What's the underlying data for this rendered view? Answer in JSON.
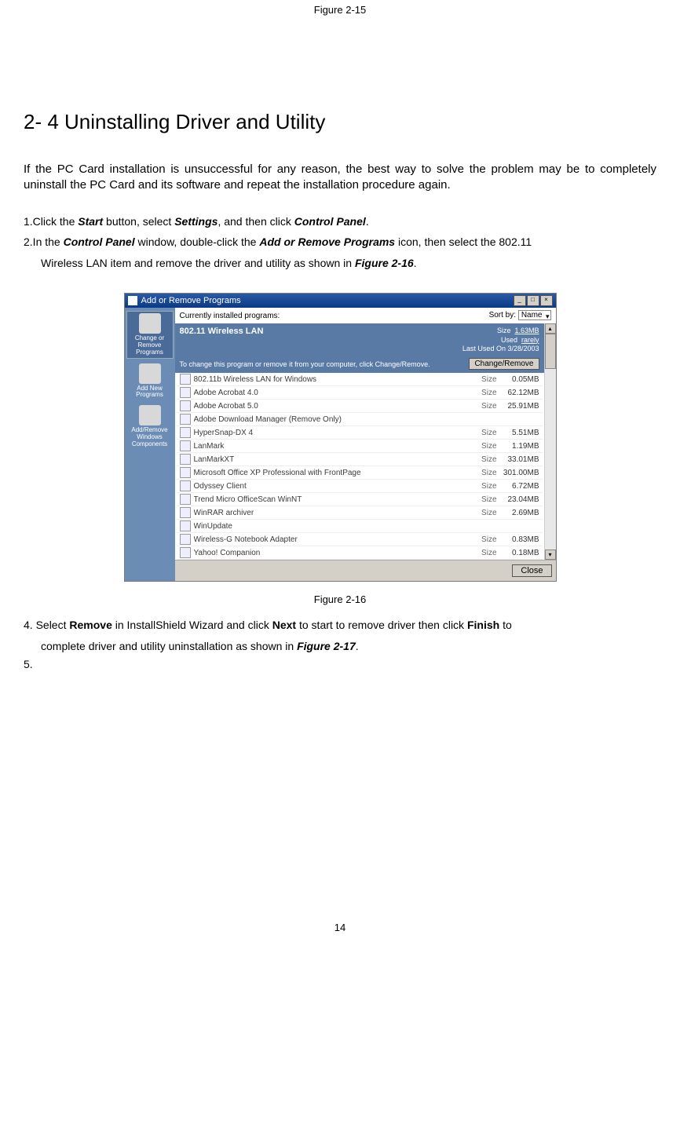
{
  "fig_top": "Figure 2-15",
  "section_title": "2- 4 Uninstalling Driver and Utility",
  "intro": "If the PC Card installation is unsuccessful for any reason, the best way to solve the problem may be to completely uninstall the PC Card and its software and repeat the installation procedure again.",
  "step1_pre": "1.Click the ",
  "step1_b1": "Start",
  "step1_mid1": " button, select ",
  "step1_b2": "Settings",
  "step1_mid2": ", and then click ",
  "step1_b3": "Control Panel",
  "step1_end": ".",
  "step2_pre": "2.In the ",
  "step2_b1": "Control Panel",
  "step2_mid1": " window, double-click the ",
  "step2_b2": "Add or Remove Programs",
  "step2_mid2": " icon, then select the 802.11",
  "step2_line2_pre": "Wireless LAN item and remove the driver and utility as shown in ",
  "step2_line2_b": "Figure 2-16",
  "step2_line2_end": ".",
  "win": {
    "title": "Add or Remove Programs",
    "sidebar": {
      "items": [
        {
          "label_l1": "Change or",
          "label_l2": "Remove",
          "label_l3": "Programs"
        },
        {
          "label_l1": "Add New",
          "label_l2": "Programs",
          "label_l3": ""
        },
        {
          "label_l1": "Add/Remove",
          "label_l2": "Windows",
          "label_l3": "Components"
        }
      ]
    },
    "topbar": {
      "label": "Currently installed programs:",
      "sort_label": "Sort by:",
      "sort_value": "Name"
    },
    "selected": {
      "name": "802.11 Wireless LAN",
      "size_label": "Size",
      "size_value": "1.63MB",
      "used_label": "Used",
      "used_value": "rarely",
      "lastused": "Last Used On   3/28/2003",
      "text": "To change this program or remove it from your computer, click Change/Remove.",
      "button": "Change/Remove"
    },
    "programs": [
      {
        "name": "802.11b Wireless LAN for Windows",
        "size": "0.05MB"
      },
      {
        "name": "Adobe Acrobat 4.0",
        "size": "62.12MB"
      },
      {
        "name": "Adobe Acrobat 5.0",
        "size": "25.91MB"
      },
      {
        "name": "Adobe Download Manager (Remove Only)",
        "size": ""
      },
      {
        "name": "HyperSnap-DX 4",
        "size": "5.51MB"
      },
      {
        "name": "LanMark",
        "size": "1.19MB"
      },
      {
        "name": "LanMarkXT",
        "size": "33.01MB"
      },
      {
        "name": "Microsoft Office XP Professional with FrontPage",
        "size": "301.00MB"
      },
      {
        "name": "Odyssey Client",
        "size": "6.72MB"
      },
      {
        "name": "Trend Micro OfficeScan WinNT",
        "size": "23.04MB"
      },
      {
        "name": "WinRAR archiver",
        "size": "2.69MB"
      },
      {
        "name": "WinUpdate",
        "size": ""
      },
      {
        "name": "Wireless-G Notebook Adapter",
        "size": "0.83MB"
      },
      {
        "name": "Yahoo! Companion",
        "size": "0.18MB"
      }
    ],
    "size_label": "Size",
    "close": "Close"
  },
  "fig_caption": "Figure 2-16",
  "step4_num": "4.",
  "step4_t1": "  Select ",
  "step4_b1": "Remove",
  "step4_t2": " in InstallShield Wizard and click ",
  "step4_b2": "Next",
  "step4_t3": " to start to remove driver then click ",
  "step4_b3": "Finish",
  "step4_t4": " to",
  "step4_line2_t1": "complete driver and utility uninstallation as shown in ",
  "step4_line2_b": "Figure 2-17",
  "step4_line2_end": ".",
  "step5": "5.",
  "page_num": "14"
}
